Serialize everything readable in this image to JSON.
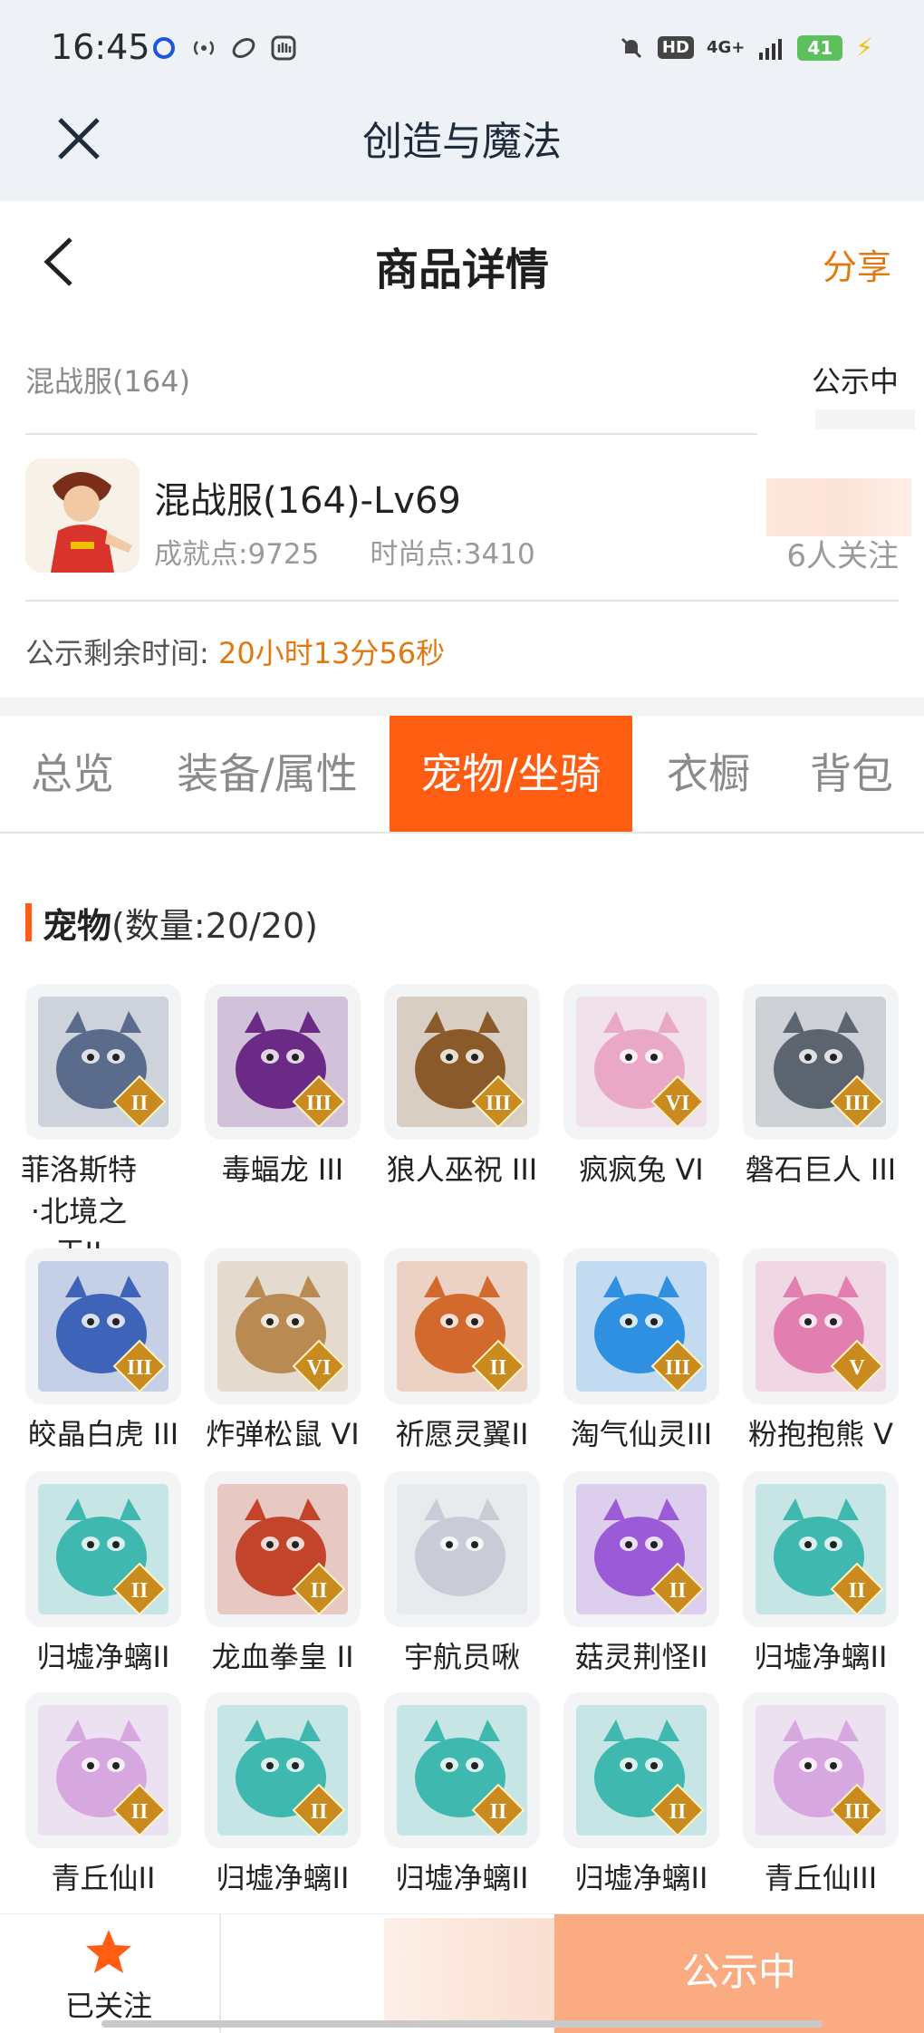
{
  "status_bar": {
    "time": "16:45",
    "network": "4G+",
    "hd_badge": "HD",
    "battery": "41"
  },
  "app": {
    "title": "创造与魔法"
  },
  "header": {
    "title": "商品详情",
    "share_label": "分享"
  },
  "listing": {
    "server": "混战服(164)",
    "status": "公示中",
    "character_name": "混战服(164)-Lv69",
    "achievement": "成就点:9725",
    "fashion": "时尚点:3410",
    "followers": "6人关注",
    "countdown_label": "公示剩余时间:",
    "countdown_value": "20小时13分56秒"
  },
  "tabs": [
    {
      "label": "总览",
      "active": false
    },
    {
      "label": "装备/属性",
      "active": false
    },
    {
      "label": "宠物/坐骑",
      "active": true
    },
    {
      "label": "衣橱",
      "active": false
    },
    {
      "label": "背包",
      "active": false
    }
  ],
  "pets_section": {
    "title": "宠物",
    "count": "(数量:20/20)"
  },
  "pets": [
    {
      "name": "菲洛斯特·北境之王II",
      "tier": "II",
      "icon": "silver-dragon-knight",
      "color": "#5a6b8c"
    },
    {
      "name": "毒蝠龙 III",
      "tier": "III",
      "icon": "purple-bat-dragon",
      "color": "#6b2a86"
    },
    {
      "name": "狼人巫祝 III",
      "tier": "III",
      "icon": "werewolf-shaman",
      "color": "#8a5a2b"
    },
    {
      "name": "疯疯兔 VI",
      "tier": "VI",
      "icon": "pink-rabbit",
      "color": "#e9a9c6"
    },
    {
      "name": "磐石巨人 III",
      "tier": "III",
      "icon": "rock-giant",
      "color": "#5c6470"
    },
    {
      "name": "皎晶白虎 III",
      "tier": "III",
      "icon": "crystal-white-tiger",
      "color": "#3d64b8"
    },
    {
      "name": "炸弹松鼠 VI",
      "tier": "VI",
      "icon": "bomb-squirrel",
      "color": "#b98a52"
    },
    {
      "name": "祈愿灵翼II",
      "tier": "II",
      "icon": "wish-eagle",
      "color": "#d26a2e"
    },
    {
      "name": "淘气仙灵III",
      "tier": "III",
      "icon": "naughty-sprite",
      "color": "#2f8fe0"
    },
    {
      "name": "粉抱抱熊 V",
      "tier": "V",
      "icon": "pink-hug-bear",
      "color": "#e27fb0"
    },
    {
      "name": "归墟净螭II",
      "tier": "II",
      "icon": "teal-dragon",
      "color": "#3fb8b0"
    },
    {
      "name": "龙血拳皇 II",
      "tier": "II",
      "icon": "dragon-blood-boxer",
      "color": "#c2452b"
    },
    {
      "name": "宇航员啾",
      "tier": "",
      "icon": "astronaut-bird",
      "color": "#c9ccd6"
    },
    {
      "name": "菇灵荆怪II",
      "tier": "II",
      "icon": "mushroom-sprite",
      "color": "#9b5bd6"
    },
    {
      "name": "归墟净螭II",
      "tier": "II",
      "icon": "teal-dragon",
      "color": "#3fb8b0"
    },
    {
      "name": "青丘仙II",
      "tier": "II",
      "icon": "fox-fairy",
      "color": "#d7a8e0"
    },
    {
      "name": "归墟净螭II",
      "tier": "II",
      "icon": "teal-dragon",
      "color": "#3fb8b0"
    },
    {
      "name": "归墟净螭II",
      "tier": "II",
      "icon": "teal-dragon",
      "color": "#3fb8b0"
    },
    {
      "name": "归墟净螭II",
      "tier": "II",
      "icon": "teal-dragon",
      "color": "#3fb8b0"
    },
    {
      "name": "青丘仙III",
      "tier": "III",
      "icon": "fox-fairy",
      "color": "#d7a8e0"
    }
  ],
  "bottom_bar": {
    "follow_label": "已关注",
    "action_label": "公示中"
  },
  "colors": {
    "accent": "#ff5e12",
    "orange_text": "#e07a10",
    "action_button": "#fbab82"
  }
}
